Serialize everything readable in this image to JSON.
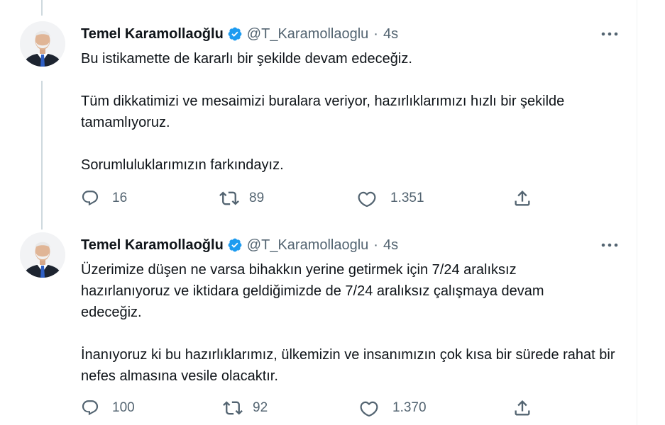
{
  "colors": {
    "text": "#0f1419",
    "secondary": "#536471",
    "verified": "#1d9bf0",
    "thread_line": "#cfd9de"
  },
  "tweets": [
    {
      "author_name": "Temel Karamollaoğlu",
      "handle": "@T_Karamollaoglu",
      "separator": "·",
      "time": "4s",
      "paragraphs": [
        "Bu istikamette de kararlı bir şekilde devam edeceğiz.",
        "Tüm dikkatimizi ve mesaimizi buralara veriyor, hazırlıklarımızı hızlı bir şekilde tamamlıyoruz.",
        "Sorumluluklarımızın farkındayız."
      ],
      "reply_count": "16",
      "retweet_count": "89",
      "like_count": "1.351"
    },
    {
      "author_name": "Temel Karamollaoğlu",
      "handle": "@T_Karamollaoglu",
      "separator": "·",
      "time": "4s",
      "paragraphs": [
        "Üzerimize düşen ne varsa bihakkın yerine getirmek için 7/24 aralıksız hazırlanıyoruz ve iktidara geldiğimizde de 7/24 aralıksız çalışmaya devam edeceğiz.",
        "İnanıyoruz ki bu hazırlıklarımız, ülkemizin ve insanımızın çok kısa bir sürede rahat bir nefes almasına vesile olacaktır."
      ],
      "reply_count": "100",
      "retweet_count": "92",
      "like_count": "1.370"
    }
  ]
}
